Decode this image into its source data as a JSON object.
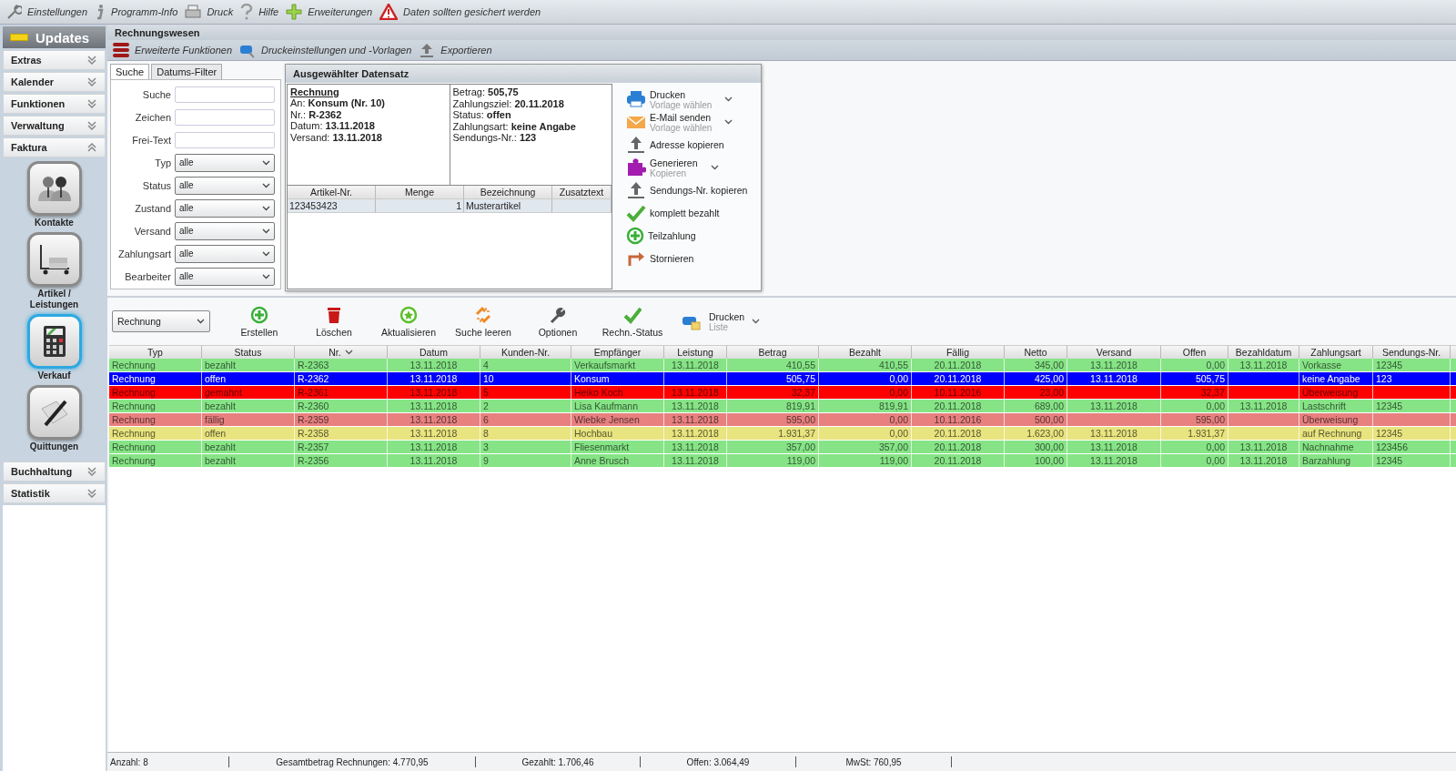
{
  "menu": [
    {
      "label": "Einstellungen"
    },
    {
      "label": "Programm-Info"
    },
    {
      "label": "Druck"
    },
    {
      "label": "Hilfe"
    },
    {
      "label": "Erweiterungen"
    },
    {
      "label": "Daten sollten gesichert werden"
    }
  ],
  "sidebar": {
    "title": "Updates",
    "sections": [
      {
        "label": "Extras",
        "expanded": false
      },
      {
        "label": "Kalender",
        "expanded": false
      },
      {
        "label": "Funktionen",
        "expanded": false
      },
      {
        "label": "Verwaltung",
        "expanded": false
      },
      {
        "label": "Faktura",
        "expanded": true,
        "items": [
          {
            "label": "Kontakte",
            "selected": false
          },
          {
            "label": "Artikel / Leistungen",
            "selected": false
          },
          {
            "label": "Verkauf",
            "selected": true
          },
          {
            "label": "Quittungen",
            "selected": false
          }
        ]
      },
      {
        "label": "Buchhaltung",
        "expanded": false
      },
      {
        "label": "Statistik",
        "expanded": false
      }
    ]
  },
  "module": {
    "title": "Rechnungswesen",
    "actions": [
      "Erweiterte Funktionen",
      "Druckeinstellungen und -Vorlagen",
      "Exportieren"
    ]
  },
  "filter": {
    "tabs": [
      {
        "label": "Suche",
        "selected": true
      },
      {
        "label": "Datums-Filter",
        "selected": false
      }
    ],
    "fields": [
      {
        "label": "Suche",
        "kind": "text"
      },
      {
        "label": "Zeichen",
        "kind": "text"
      },
      {
        "label": "Frei-Text",
        "kind": "text"
      },
      {
        "label": "Typ",
        "kind": "select",
        "value": "alle"
      },
      {
        "label": "Status",
        "kind": "select",
        "value": "alle"
      },
      {
        "label": "Zustand",
        "kind": "select",
        "value": "alle"
      },
      {
        "label": "Versand",
        "kind": "select",
        "value": "alle"
      },
      {
        "label": "Zahlungsart",
        "kind": "select",
        "value": "alle"
      },
      {
        "label": "Bearbeiter",
        "kind": "select",
        "value": "alle"
      }
    ]
  },
  "detail": {
    "title": "Ausgewählter Datensatz",
    "heading": "Rechnung",
    "left": [
      {
        "label": "An:",
        "value": "Konsum (Nr. 10)"
      },
      {
        "label": "Nr.:",
        "value": "R-2362"
      },
      {
        "label": "Datum:",
        "value": "13.11.2018"
      },
      {
        "label": "Versand:",
        "value": "13.11.2018"
      }
    ],
    "right": [
      {
        "label": "Betrag:",
        "value": "505,75"
      },
      {
        "label": "Zahlungsziel:",
        "value": "20.11.2018"
      },
      {
        "label": "Status:",
        "value": "offen"
      },
      {
        "label": "Zahlungsart:",
        "value": "keine Angabe"
      },
      {
        "label": "Sendungs-Nr.:",
        "value": "123"
      }
    ],
    "item_columns": [
      "Artikel-Nr.",
      "Menge",
      "Bezeichnung",
      "Zusatztext"
    ],
    "item_rows": [
      {
        "artikel_nr": "123453423",
        "menge": "1",
        "bezeichnung": "Musterartikel"
      }
    ],
    "actions": [
      {
        "label": "Drucken",
        "sublabel": "Vorlage wählen",
        "kind": "menu"
      },
      {
        "label": "E-Mail senden",
        "sublabel": "Vorlage wählen",
        "kind": "menu"
      },
      {
        "label": "Adresse kopieren",
        "kind": "plain"
      },
      {
        "label": "Generieren",
        "sublabel": "Kopieren",
        "kind": "menu"
      },
      {
        "label": "Sendungs-Nr. kopieren",
        "kind": "plain"
      },
      {
        "label": "komplett bezahlt",
        "kind": "plain"
      },
      {
        "label": "Teilzahlung",
        "kind": "plain"
      },
      {
        "label": "Stornieren",
        "kind": "plain"
      }
    ]
  },
  "toolbar": {
    "type_select": "Rechnung",
    "buttons": [
      {
        "label": "Erstellen",
        "kind": "button"
      },
      {
        "label": "Löschen",
        "kind": "button"
      },
      {
        "label": "Aktualisieren",
        "kind": "button"
      },
      {
        "label": "Suche leeren",
        "kind": "button"
      },
      {
        "label": "Optionen",
        "kind": "button"
      },
      {
        "label": "Rechn.-Status",
        "kind": "button"
      },
      {
        "label": "Drucken",
        "sublabel": "Liste",
        "kind": "menu"
      }
    ]
  },
  "table": {
    "columns": [
      {
        "label": "Typ",
        "sorted": false
      },
      {
        "label": "Status",
        "sorted": false
      },
      {
        "label": "Nr.",
        "sorted": true
      },
      {
        "label": "Datum",
        "sorted": false
      },
      {
        "label": "Kunden-Nr.",
        "sorted": false
      },
      {
        "label": "Empfänger",
        "sorted": false
      },
      {
        "label": "Leistung",
        "sorted": false
      },
      {
        "label": "Betrag",
        "sorted": false
      },
      {
        "label": "Bezahlt",
        "sorted": false
      },
      {
        "label": "Fällig",
        "sorted": false
      },
      {
        "label": "Netto",
        "sorted": false
      },
      {
        "label": "Versand",
        "sorted": false
      },
      {
        "label": "Offen",
        "sorted": false
      },
      {
        "label": "Bezahldatum",
        "sorted": false
      },
      {
        "label": "Zahlungsart",
        "sorted": false
      },
      {
        "label": "Sendungs-Nr.",
        "sorted": false
      }
    ],
    "rows": [
      {
        "color": "#86e486",
        "selected": false,
        "cells": [
          "Rechnung",
          "bezahlt",
          "R-2363",
          "13.11.2018",
          "4",
          "Verkaufsmarkt",
          "13.11.2018",
          "410,55",
          "410,55",
          "20.11.2018",
          "345,00",
          "13.11.2018",
          "0,00",
          "13.11.2018",
          "Vorkasse",
          "12345"
        ]
      },
      {
        "selected": true,
        "cells": [
          "Rechnung",
          "offen",
          "R-2362",
          "13.11.2018",
          "10",
          "Konsum",
          null,
          "505,75",
          "0,00",
          "20.11.2018",
          "425,00",
          "13.11.2018",
          "505,75",
          null,
          "keine Angabe",
          "123"
        ]
      },
      {
        "color": "#ff0000",
        "selected": false,
        "cells": [
          "Rechnung",
          "gemahnt",
          "R-2361",
          "13.11.2018",
          "5",
          "Heiko Koch",
          "13.11.2018",
          "32,37",
          "0,00",
          "10.11.2016",
          "23,00",
          null,
          "32,37",
          null,
          "Überweisung",
          null
        ]
      },
      {
        "color": "#86e486",
        "selected": false,
        "cells": [
          "Rechnung",
          "bezahlt",
          "R-2360",
          "13.11.2018",
          "2",
          "Lisa Kaufmann",
          "13.11.2018",
          "819,91",
          "819,91",
          "20.11.2018",
          "689,00",
          "13.11.2018",
          "0,00",
          "13.11.2018",
          "Lastschrift",
          "12345"
        ]
      },
      {
        "color": "#e88080",
        "selected": false,
        "cells": [
          "Rechnung",
          "fällig",
          "R-2359",
          "13.11.2018",
          "6",
          "Wiebke Jensen",
          "13.11.2018",
          "595,00",
          "0,00",
          "10.11.2016",
          "500,00",
          null,
          "595,00",
          null,
          "Überweisung",
          null
        ]
      },
      {
        "color": "#e8e47f",
        "selected": false,
        "cells": [
          "Rechnung",
          "offen",
          "R-2358",
          "13.11.2018",
          "8",
          "Hochbau",
          "13.11.2018",
          "1.931,37",
          "0,00",
          "20.11.2018",
          "1.623,00",
          "13.11.2018",
          "1.931,37",
          null,
          "auf Rechnung",
          "12345"
        ]
      },
      {
        "color": "#86e486",
        "selected": false,
        "cells": [
          "Rechnung",
          "bezahlt",
          "R-2357",
          "13.11.2018",
          "3",
          "Fliesenmarkt",
          "13.11.2018",
          "357,00",
          "357,00",
          "20.11.2018",
          "300,00",
          "13.11.2018",
          "0,00",
          "13.11.2018",
          "Nachnahme",
          "123456"
        ]
      },
      {
        "color": "#86e486",
        "selected": false,
        "cells": [
          "Rechnung",
          "bezahlt",
          "R-2356",
          "13.11.2018",
          "9",
          "Anne Brusch",
          "13.11.2018",
          "119,00",
          "119,00",
          "20.11.2018",
          "100,00",
          "13.11.2018",
          "0,00",
          "13.11.2018",
          "Barzahlung",
          "12345"
        ]
      }
    ]
  },
  "status_bar": [
    "Anzahl: 8",
    "Gesamtbetrag Rechnungen: 4.770,95",
    "Gezahlt: 1.706,46",
    "Offen: 3.064,49",
    "MwSt: 760,95"
  ]
}
